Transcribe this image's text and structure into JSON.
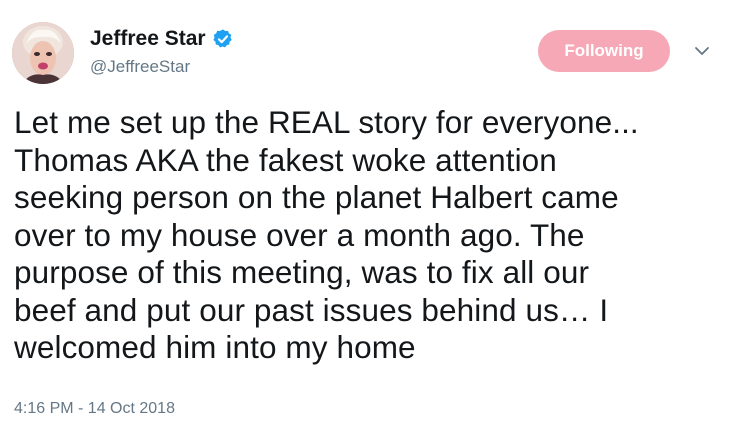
{
  "author": {
    "display_name": "Jeffree Star",
    "handle": "@JeffreeStar",
    "verified_icon": "verified-badge-icon",
    "avatar_icon": "profile-avatar"
  },
  "follow_button": {
    "label": "Following",
    "color": "#f6a8b6"
  },
  "menu": {
    "icon": "chevron-down-icon"
  },
  "tweet": {
    "text": "Let me set up the REAL story for everyone...\nThomas AKA the fakest woke attention\nseeking person on the planet Halbert came\nover to my house over a month ago. The\npurpose of this meeting, was to fix all our\nbeef and put our past issues behind us… I\nwelcomed him into my home",
    "timestamp": "4:16 PM - 14 Oct 2018"
  },
  "colors": {
    "text": "#14171a",
    "secondary": "#657786",
    "verified": "#1da1f2"
  }
}
